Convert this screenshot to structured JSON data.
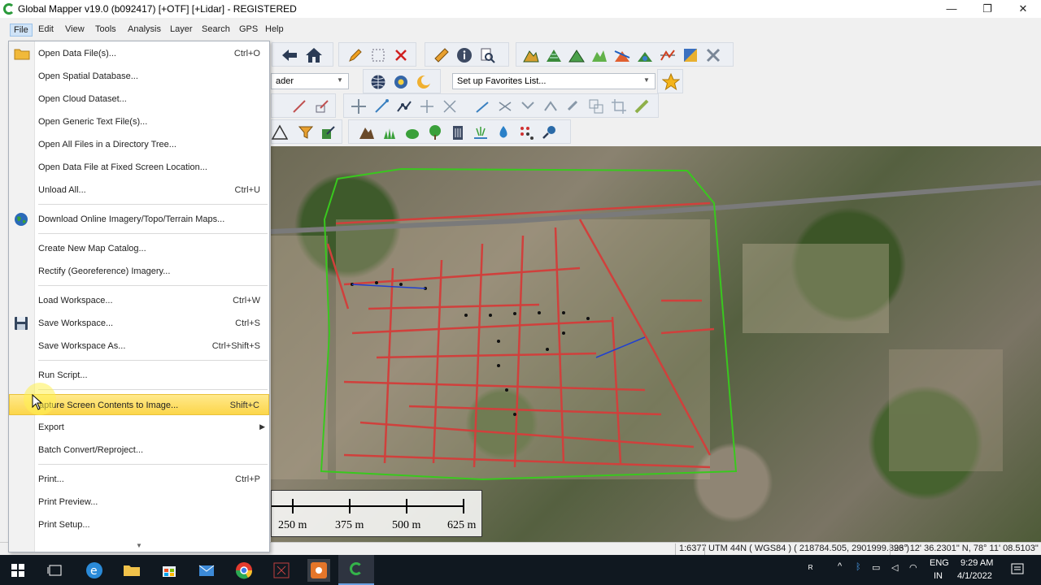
{
  "window": {
    "title": "Global Mapper v19.0 (b092417) [+OTF] [+Lidar] - REGISTERED",
    "minimize": "—",
    "maximize": "❐",
    "close": "✕"
  },
  "menubar": [
    "File",
    "Edit",
    "View",
    "Tools",
    "Analysis",
    "Layer",
    "Search",
    "GPS",
    "Help"
  ],
  "toolbars": {
    "shader_combo": "ader",
    "favorites_combo": "Set up Favorites List..."
  },
  "file_menu": {
    "items": [
      {
        "label": "Open Data File(s)...",
        "shortcut": "Ctrl+O",
        "icon": "folder-icon"
      },
      {
        "label": "Open Spatial Database...",
        "shortcut": ""
      },
      {
        "label": "Open Cloud Dataset...",
        "shortcut": ""
      },
      {
        "label": "Open Generic Text File(s)...",
        "shortcut": ""
      },
      {
        "label": "Open All Files in a Directory Tree...",
        "shortcut": ""
      },
      {
        "label": "Open Data File at Fixed Screen Location...",
        "shortcut": ""
      },
      {
        "label": "Unload All...",
        "shortcut": "Ctrl+U"
      },
      {
        "label": "Download Online Imagery/Topo/Terrain Maps...",
        "shortcut": "",
        "icon": "globe-icon"
      },
      {
        "label": "Create New Map Catalog...",
        "shortcut": ""
      },
      {
        "label": "Rectify (Georeference) Imagery...",
        "shortcut": ""
      },
      {
        "label": "Load Workspace...",
        "shortcut": "Ctrl+W"
      },
      {
        "label": "Save Workspace...",
        "shortcut": "Ctrl+S",
        "icon": "floppy-disk-icon"
      },
      {
        "label": "Save Workspace As...",
        "shortcut": "Ctrl+Shift+S"
      },
      {
        "label": "Run Script...",
        "shortcut": ""
      },
      {
        "label": "apture Screen Contents to Image...",
        "shortcut": "Shift+C",
        "highlighted": true
      },
      {
        "label": "Export",
        "shortcut": "",
        "submenu": true
      },
      {
        "label": "Batch Convert/Reproject...",
        "shortcut": ""
      },
      {
        "label": "Print...",
        "shortcut": "Ctrl+P"
      },
      {
        "label": "Print Preview...",
        "shortcut": ""
      },
      {
        "label": "Print Setup...",
        "shortcut": ""
      }
    ]
  },
  "scalebar": {
    "labels": [
      "250 m",
      "375 m",
      "500 m",
      "625 m"
    ]
  },
  "statusbar": {
    "scale": "1:6377",
    "projection": "UTM 44N ( WGS84 ) ( 218784.505, 2901999.393 )",
    "latlon": "26° 12' 36.2301\" N, 78° 11' 08.5103\" E"
  },
  "taskbar": {
    "lang_top": "ENG",
    "lang_bottom": "IN",
    "time": "9:29 AM",
    "date": "4/1/2022"
  },
  "colors": {
    "highlight": "#fcd64a",
    "road_red": "#d0403c",
    "boundary_green": "#39c81e"
  }
}
